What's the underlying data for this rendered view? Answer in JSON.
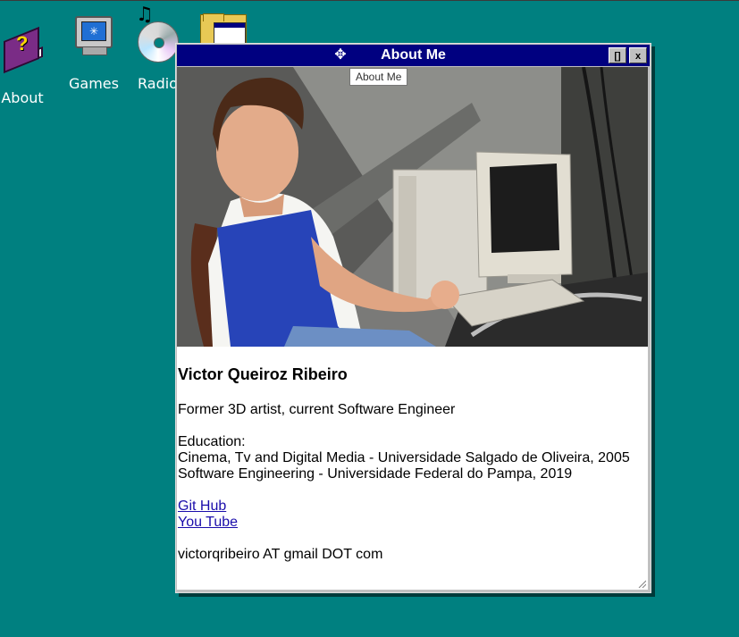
{
  "desktop": {
    "icons": [
      {
        "label": "About",
        "icon": "help-book-icon"
      },
      {
        "label": "Games",
        "icon": "monitor-icon"
      },
      {
        "label": "Radio",
        "icon": "cd-music-icon"
      },
      {
        "label": "",
        "icon": "folder-icon"
      }
    ],
    "background": "#008080"
  },
  "window": {
    "title": "About Me",
    "tooltip": "About Me",
    "maximize_label": "[]",
    "close_label": "x",
    "photo_alt": "Boy sitting at an old beige computer",
    "name": "Victor Queiroz Ribeiro",
    "tagline": "Former 3D artist, current Software Engineer",
    "education_heading": "Education:",
    "education": [
      "Cinema, Tv and Digital Media - Universidade Salgado de Oliveira, 2005",
      "Software Engineering - Universidade Federal do Pampa, 2019"
    ],
    "links": [
      "Git Hub",
      "You Tube"
    ],
    "email": "victorqribeiro AT gmail DOT com"
  },
  "colors": {
    "titlebar": "#000080",
    "window": "#c0c0c0",
    "link": "#1a0dab"
  }
}
